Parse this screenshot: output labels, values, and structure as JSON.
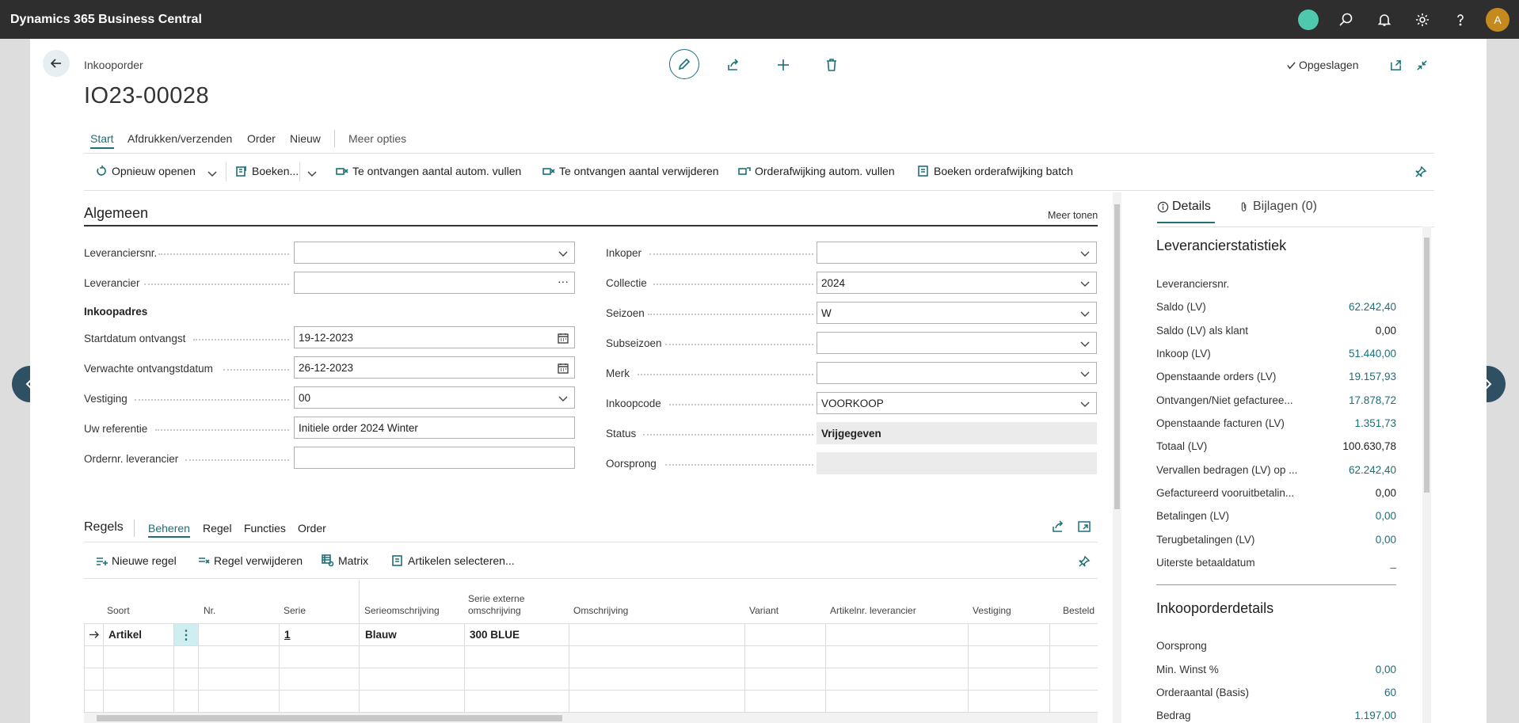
{
  "app": {
    "title": "Dynamics 365 Business Central",
    "avatar_initial": "A"
  },
  "header": {
    "breadcrumb": "Inkooporder",
    "title": "IO23-00028",
    "saved_label": "Opgeslagen"
  },
  "tabs": [
    {
      "label": "Start"
    },
    {
      "label": "Afdrukken/verzenden"
    },
    {
      "label": "Order"
    },
    {
      "label": "Nieuw"
    },
    {
      "label": "Meer opties"
    }
  ],
  "actions": [
    {
      "label": "Opnieuw openen"
    },
    {
      "label": "Boeken..."
    },
    {
      "label": "Te ontvangen aantal autom. vullen"
    },
    {
      "label": "Te ontvangen aantal verwijderen"
    },
    {
      "label": "Orderafwijking autom. vullen"
    },
    {
      "label": "Boeken orderafwijking batch"
    }
  ],
  "general": {
    "title": "Algemeen",
    "more_label": "Meer tonen",
    "address_title": "Inkoopadres",
    "left_fields": [
      {
        "label": "Leveranciersnr.",
        "value": ""
      },
      {
        "label": "Leverancier",
        "value": ""
      },
      {
        "label": "Startdatum ontvangst",
        "value": "19-12-2023"
      },
      {
        "label": "Verwachte ontvangstdatum",
        "value": "26-12-2023"
      },
      {
        "label": "Vestiging",
        "value": "00"
      },
      {
        "label": "Uw referentie",
        "value": "Initiele order 2024 Winter"
      },
      {
        "label": "Ordernr. leverancier",
        "value": ""
      }
    ],
    "right_fields": [
      {
        "label": "Inkoper",
        "value": ""
      },
      {
        "label": "Collectie",
        "value": "2024"
      },
      {
        "label": "Seizoen",
        "value": "W"
      },
      {
        "label": "Subseizoen",
        "value": ""
      },
      {
        "label": "Merk",
        "value": ""
      },
      {
        "label": "Inkoopcode",
        "value": "VOORKOOP"
      },
      {
        "label": "Status",
        "value": "Vrijgegeven"
      },
      {
        "label": "Oorsprong",
        "value": ""
      }
    ]
  },
  "lines": {
    "title": "Regels",
    "tabs": [
      {
        "label": "Beheren"
      },
      {
        "label": "Regel"
      },
      {
        "label": "Functies"
      },
      {
        "label": "Order"
      }
    ],
    "actions": [
      {
        "label": "Nieuwe regel"
      },
      {
        "label": "Regel verwijderen"
      },
      {
        "label": "Matrix"
      },
      {
        "label": "Artikelen selecteren..."
      }
    ],
    "columns": [
      "Soort",
      "Nr.",
      "Serie",
      "Serieomschrijving",
      "Serie externe omschrijving",
      "Omschrijving",
      "Variant",
      "Artikelnr. leverancier",
      "Vestiging",
      "Besteld"
    ],
    "rows": [
      {
        "soort": "Artikel",
        "nr": "",
        "serie": "1",
        "serieomschrijving": "Blauw",
        "extern": "300 BLUE"
      }
    ]
  },
  "factbox": {
    "tabs": [
      {
        "label": "Details"
      },
      {
        "label": "Bijlagen (0)"
      }
    ],
    "stats_title": "Leverancierstatistiek",
    "stats": [
      {
        "label": "Leveranciersnr.",
        "value": ""
      },
      {
        "label": "Saldo (LV)",
        "value": "62.242,40"
      },
      {
        "label": "Saldo (LV) als klant",
        "value": "0,00"
      },
      {
        "label": "Inkoop (LV)",
        "value": "51.440,00"
      },
      {
        "label": "Openstaande orders (LV)",
        "value": "19.157,93"
      },
      {
        "label": "Ontvangen/Niet gefacturee...",
        "value": "17.878,72"
      },
      {
        "label": "Openstaande facturen (LV)",
        "value": "1.351,73"
      },
      {
        "label": "Totaal (LV)",
        "value": "100.630,78"
      },
      {
        "label": "Vervallen bedragen (LV) op ...",
        "value": "62.242,40"
      },
      {
        "label": "Gefactureerd vooruitbetalin...",
        "value": "0,00"
      },
      {
        "label": "Betalingen (LV)",
        "value": "0,00"
      },
      {
        "label": "Terugbetalingen (LV)",
        "value": "0,00"
      },
      {
        "label": "Uiterste betaaldatum",
        "value": "_"
      }
    ],
    "details_title": "Inkooporderdetails",
    "details": [
      {
        "label": "Oorsprong",
        "value": ""
      },
      {
        "label": "Min. Winst %",
        "value": "0,00"
      },
      {
        "label": "Orderaantal (Basis)",
        "value": "60"
      },
      {
        "label": "Bedrag",
        "value": "1.197,00"
      }
    ]
  }
}
